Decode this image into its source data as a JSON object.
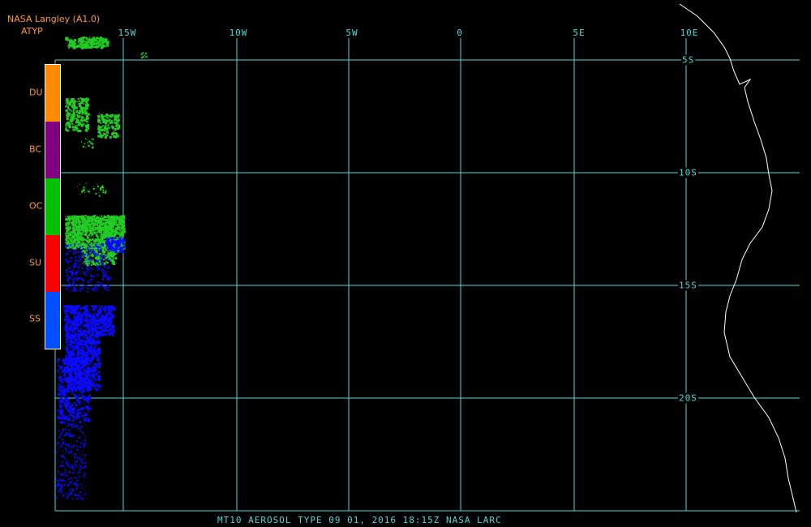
{
  "header": {
    "line1": "NASA Langley (A1.0)",
    "line2": "ATYP"
  },
  "footer_text": "MT10   AEROSOL TYPE   09 01, 2016 18:15Z   NASA LARC",
  "grid": {
    "lon_labels": [
      "15W",
      "10W",
      "5W",
      "0",
      "5E",
      "10E"
    ],
    "lat_labels": [
      "5S",
      "10S",
      "15S",
      "20S"
    ],
    "color": "#4fd8d8"
  },
  "legend": {
    "items": [
      {
        "code": "DU",
        "color": "#ff8c00"
      },
      {
        "code": "BC",
        "color": "#800080"
      },
      {
        "code": "OC",
        "color": "#00c000"
      },
      {
        "code": "SU",
        "color": "#ff0000"
      },
      {
        "code": "SS",
        "color": "#0050ff"
      }
    ]
  },
  "coastline_color": "#ffffff",
  "aerosol_colors": {
    "OC": "#22cc22",
    "SS": "#0a0aff"
  }
}
